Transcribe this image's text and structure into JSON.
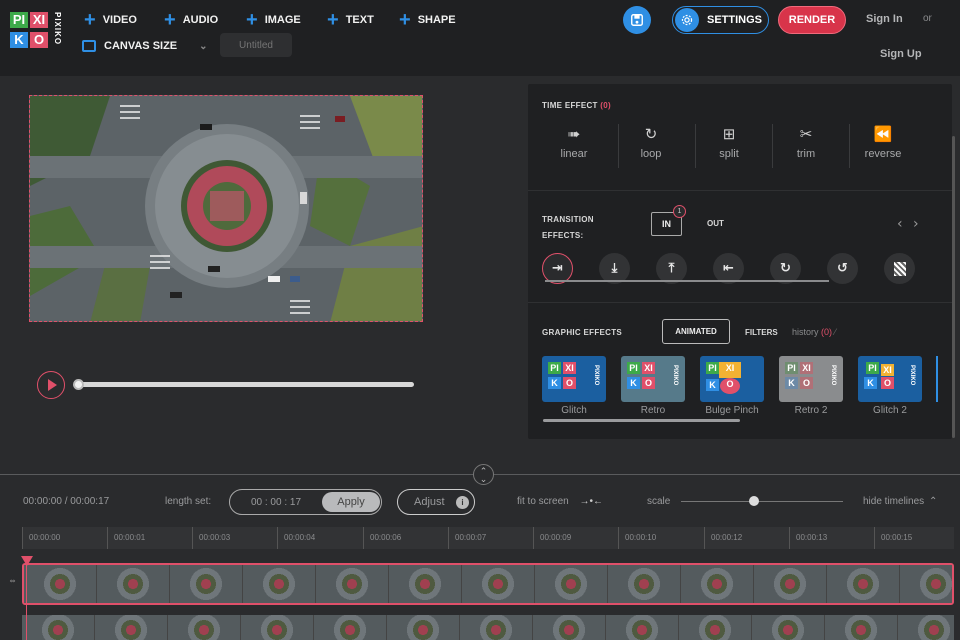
{
  "logo": {
    "cells": [
      "PI",
      "XI",
      "K",
      "O",
      "·"
    ],
    "side_text": "PIXIKO",
    "colors": {
      "blue": "#2f8fe4",
      "red": "#e0506a",
      "yellow": "#f2b233",
      "green": "#3daa4a"
    }
  },
  "header": {
    "add_video": "VIDEO",
    "add_audio": "AUDIO",
    "add_image": "IMAGE",
    "add_text": "TEXT",
    "add_shape": "SHAPE",
    "canvas_size": "CANVAS SIZE",
    "title_placeholder": "Untitled",
    "settings": "SETTINGS",
    "render": "RENDER",
    "sign_in": "Sign In",
    "or": "or",
    "sign_up": "Sign Up"
  },
  "panel": {
    "time_effect_label": "TIME EFFECT",
    "time_effect_count": "(0)",
    "time_effects": [
      "linear",
      "loop",
      "split",
      "trim",
      "reverse"
    ],
    "time_effect_icons": [
      "arrow-right-icon",
      "loop-icon",
      "split-icon",
      "scissors-icon",
      "rewind-icon"
    ],
    "transition_label_1": "TRANSITION",
    "transition_label_2": "EFFECTS:",
    "in_label": "IN",
    "in_badge": "1",
    "out_label": "OUT",
    "transition_icons": [
      "slide-right-icon",
      "slide-down-icon",
      "slide-up-icon",
      "slide-left-icon",
      "rotate-cw-icon",
      "rotate-ccw-icon",
      "dissolve-icon"
    ],
    "graphic_label": "GRAPHIC EFFECTS",
    "animated_tab": "ANIMATED",
    "filters_tab": "FILTERS",
    "history_label": "history",
    "history_count": "(0)",
    "graphic_effects": [
      "Glitch",
      "Retro",
      "Bulge Pinch",
      "Retro 2",
      "Glitch 2"
    ]
  },
  "timeline": {
    "time_display": "00:00:00 / 00:00:17",
    "length_set_label": "length set:",
    "length_value": "00 : 00 : 17",
    "apply": "Apply",
    "adjust": "Adjust",
    "adjust_info": "i",
    "fit_to_screen": "fit to screen",
    "scale": "scale",
    "hide_timelines": "hide timelines",
    "ticks": [
      "00:00:00",
      "00:00:01",
      "00:00:03",
      "00:00:04",
      "00:00:06",
      "00:00:07",
      "00:00:09",
      "00:00:10",
      "00:00:12",
      "00:00:13",
      "00:00:15"
    ],
    "scale_level": 0.45,
    "progress": 0
  },
  "accent_color": "#2f8fe4",
  "render_color": "#d8344a"
}
